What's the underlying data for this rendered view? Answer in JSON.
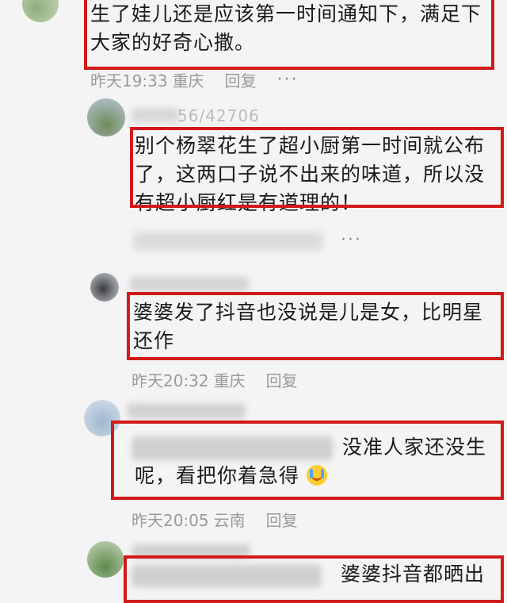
{
  "comments": [
    {
      "text_lines": [
        "生了娃儿还是应该第一时间通知下，满足下",
        "大家的好奇心撒。"
      ],
      "time": "昨天19:33",
      "location": "重庆",
      "reply": "回复",
      "more": "···"
    },
    {
      "username": "56/42706",
      "text_lines": [
        "别个杨翠花生了超小厨第一时间就公布",
        "了，这两口子说不出来的味道，所以没",
        "有超小厨红是有道理的！"
      ],
      "more": "···"
    },
    {
      "text_lines": [
        "婆婆发了抖音也没说是儿是女，比明星",
        "还作"
      ],
      "time": "昨天20:32",
      "location": "重庆",
      "reply": "回复"
    },
    {
      "text_lines": [
        "没准人家还没生",
        "呢，看把你着急得"
      ],
      "time": "昨天20:05",
      "location": "云南",
      "reply": "回复",
      "emoji": "crying-laughing-emoji"
    },
    {
      "text_lines": [
        "婆婆抖音都晒出"
      ]
    }
  ],
  "colors": {
    "highlight": "#d11a1a",
    "background": "#f4f4f4",
    "meta_text": "#9a9a9a"
  }
}
